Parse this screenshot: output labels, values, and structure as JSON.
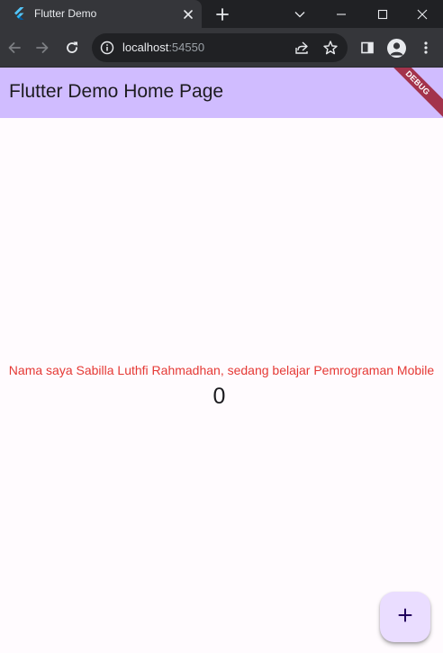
{
  "browser": {
    "tab": {
      "title": "Flutter Demo",
      "favicon": "flutter-logo-icon"
    },
    "address": {
      "host": "localhost",
      "port": ":54550"
    },
    "colors": {
      "frame": "#202124",
      "toolbar": "#35363a",
      "omnibox": "#202124"
    }
  },
  "app": {
    "appbar": {
      "title": "Flutter Demo Home Page",
      "color": "#d0bcff"
    },
    "debug_banner": "DEBUG",
    "message": "Nama saya Sabilla Luthfi Rahmadhan, sedang belajar Pemrograman Mobile",
    "message_color": "#e53935",
    "counter": "0",
    "fab": {
      "icon": "add-icon",
      "color": "#eaddff"
    },
    "background": "#fffbfe"
  }
}
